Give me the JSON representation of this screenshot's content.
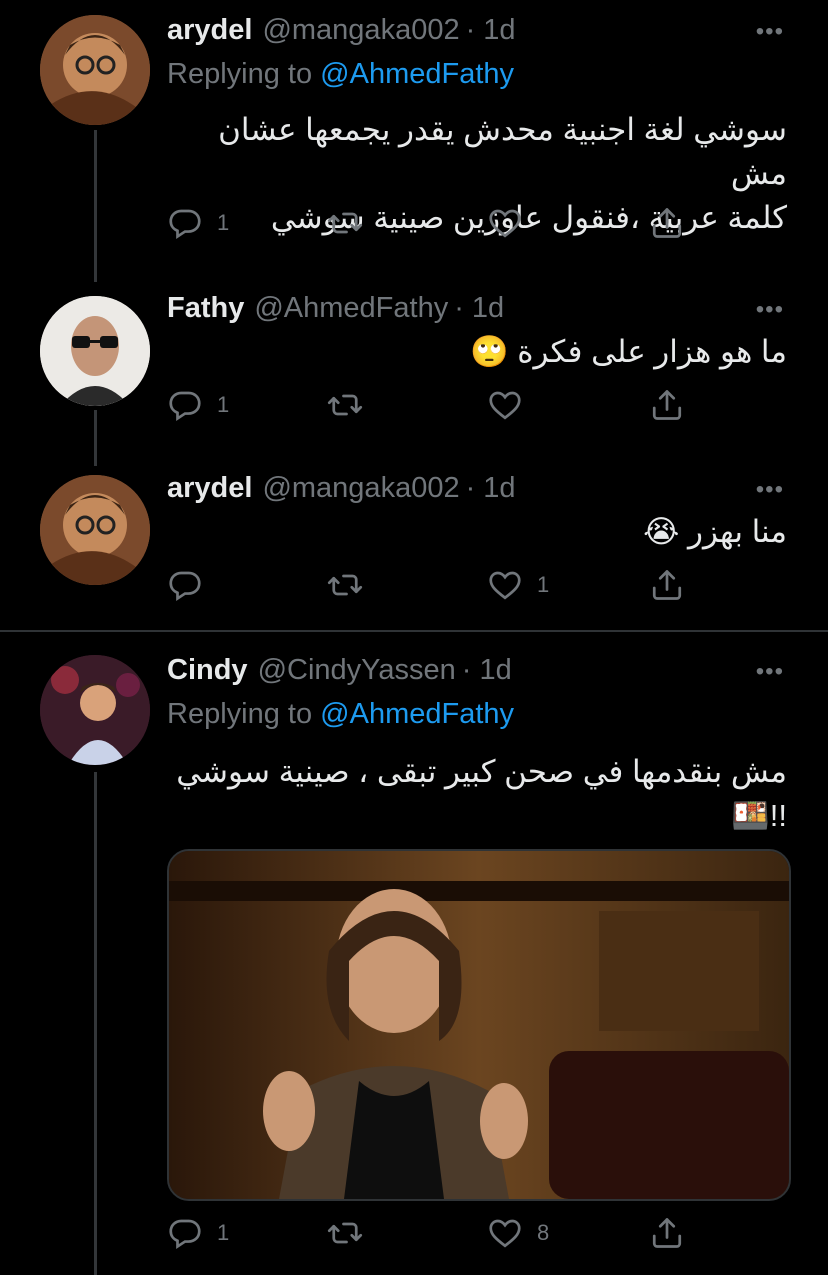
{
  "tweets": [
    {
      "name": "arydel",
      "handle": "@mangaka002",
      "time": "· 1d",
      "more": "•••",
      "replying_prefix": "Replying to ",
      "replying_mention": "@AhmedFathy",
      "text_line1": "سوشي لغة اجنبية محدش يقدر يجمعها عشان مش",
      "text_line2": "كلمة عربية ،فنقول عاوزين صينية سوشي",
      "reply_count": "1",
      "retweet_count": "",
      "like_count": ""
    },
    {
      "name": "Fathy",
      "handle": "@AhmedFathy",
      "time": "· 1d",
      "more": "•••",
      "text_line1": "ما هو هزار على فكرة",
      "emoji": "🙄",
      "reply_count": "1",
      "retweet_count": "",
      "like_count": ""
    },
    {
      "name": "arydel",
      "handle": "@mangaka002",
      "time": "· 1d",
      "more": "•••",
      "text_line1": "منا بهزر",
      "emoji": "😭",
      "reply_count": "",
      "retweet_count": "",
      "like_count": "1"
    },
    {
      "name": "Cindy",
      "handle": "@CindyYassen",
      "time": "· 1d",
      "more": "•••",
      "replying_prefix": "Replying to ",
      "replying_mention": "@AhmedFathy",
      "text_line1": "مش بنقدمها في صحن كبير تبقى ، صينية سوشي",
      "text_line2": "!!",
      "emoji": "🍱",
      "reply_count": "1",
      "retweet_count": "",
      "like_count": "8"
    }
  ],
  "colors": {
    "background": "#000000",
    "text": "#e7e9ea",
    "secondary": "#71767b",
    "accent": "#1d9bf0",
    "divider": "#2f3336"
  },
  "icons": [
    "reply-icon",
    "retweet-icon",
    "like-icon",
    "share-icon",
    "more-icon"
  ]
}
